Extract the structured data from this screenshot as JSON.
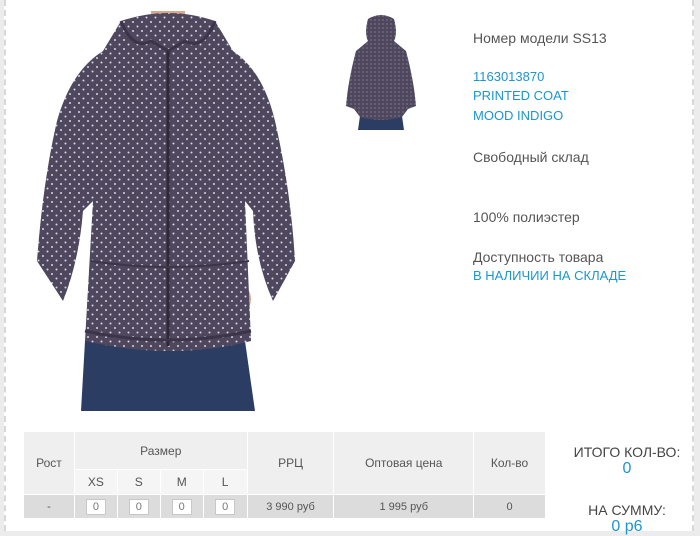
{
  "product": {
    "model_label": "Номер модели SS13",
    "code": "1163013870",
    "name": "PRINTED COAT",
    "color": "MOOD INDIGO",
    "fit": "Свободный склад",
    "material": "100% полиэстер",
    "availability_label": "Доступность товара",
    "availability_value": "В НАЛИЧИИ НА СКЛАДЕ"
  },
  "table": {
    "headers": {
      "height": "Рост",
      "size": "Размер",
      "rrp": "РРЦ",
      "wholesale": "Оптовая цена",
      "qty": "Кол-во"
    },
    "sizes": [
      "XS",
      "S",
      "M",
      "L"
    ],
    "row": {
      "height": "-",
      "size_qty": [
        "0",
        "0",
        "0",
        "0"
      ],
      "rrp": "3 990 руб",
      "wholesale": "1 995 руб",
      "qty": "0"
    }
  },
  "totals": {
    "qty_label": "ИТОГО КОЛ-ВО:",
    "qty_value": "0",
    "sum_label": "НА СУММУ:",
    "sum_value": "0 р6"
  },
  "colors": {
    "accent": "#1a96d4",
    "jacket": "#4f475e"
  }
}
